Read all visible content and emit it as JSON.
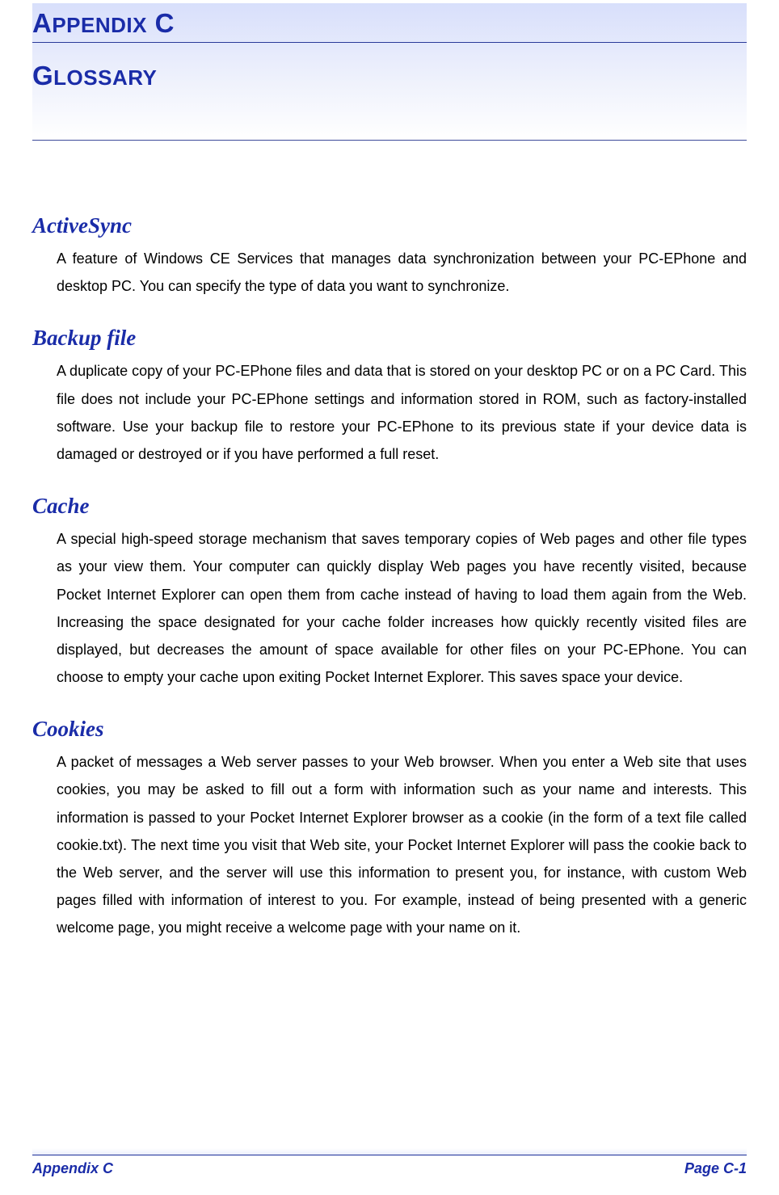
{
  "header": {
    "title_prefix_caps": "A",
    "title_prefix_rest": "PPENDIX",
    "title_suffix_caps": " C",
    "subtitle_caps": "G",
    "subtitle_rest": "LOSSARY"
  },
  "terms": {
    "activesync": {
      "name": "ActiveSync",
      "def": "A feature of Windows CE Services that manages data synchronization between your PC-EPhone and desktop PC. You can specify the type of data you want to synchronize."
    },
    "backup": {
      "name": "Backup file",
      "def": "A duplicate copy of your PC-EPhone files and data that is stored on your desktop PC or on a PC Card. This file does not include your PC-EPhone settings and information stored in ROM, such as factory-installed software. Use your backup file to restore your PC-EPhone to its previous state if your device data is damaged or destroyed or if you have performed a full reset."
    },
    "cache": {
      "name": "Cache",
      "def": "A special high-speed storage mechanism that saves temporary copies of Web pages and other file types as your view them. Your computer can quickly display Web pages you have recently visited, because Pocket Internet Explorer can open them from cache instead of having to load them again from the Web. Increasing the space designated for your cache folder increases how quickly recently visited files are displayed, but decreases the amount of space available for other files on your PC-EPhone. You can choose to empty your cache upon exiting Pocket Internet Explorer. This saves space your device."
    },
    "cookies": {
      "name": "Cookies",
      "def": "A packet of messages a Web server passes to your Web browser. When you enter a Web site that uses cookies, you may be asked to fill out a form with information such as your name and interests. This information is passed to your Pocket Internet Explorer browser as a cookie (in the form of a text file called cookie.txt). The next time you visit that Web site, your Pocket Internet Explorer will pass the cookie back to the Web server, and the server will use this information to present you, for instance, with custom Web pages filled with information of interest to you. For example, instead of being presented with a generic welcome page, you might receive a welcome page with your name on it."
    }
  },
  "footer": {
    "left": "Appendix C",
    "right": "Page C-1"
  }
}
